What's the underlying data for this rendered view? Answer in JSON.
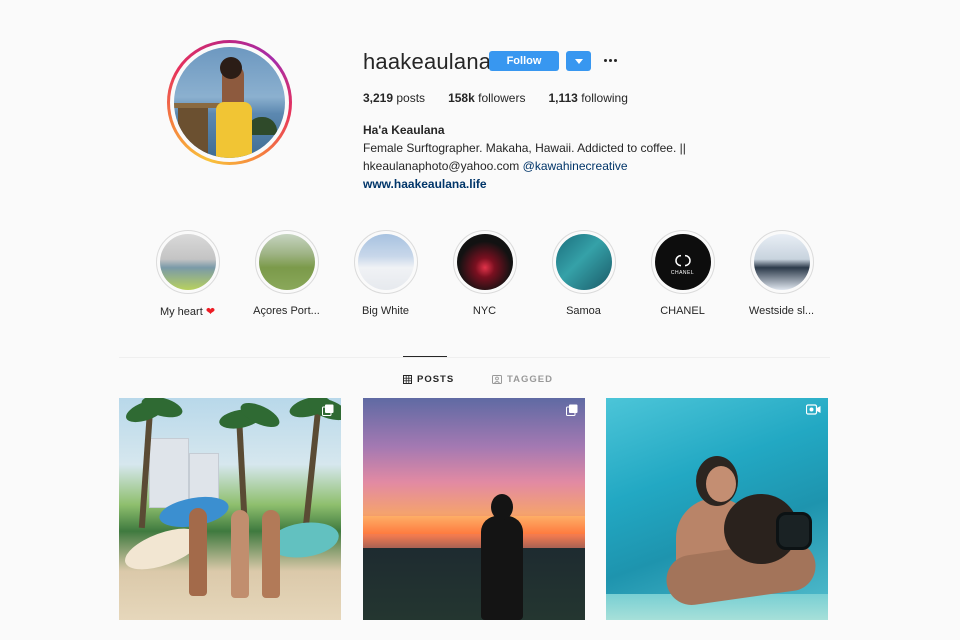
{
  "profile": {
    "username": "haakeaulana",
    "follow_label": "Follow",
    "stats": {
      "posts_count": "3,219",
      "posts_label": "posts",
      "followers_count": "158k",
      "followers_label": "followers",
      "following_count": "1,113",
      "following_label": "following"
    },
    "full_name": "Ha'a Keaulana",
    "bio_line1": "Female Surftographer. Makaha, Hawaii. Addicted to coffee. ||",
    "bio_email": "hkeaulanaphoto@yahoo.com",
    "bio_mention": "@kawahinecreative",
    "website": "www.haakeaulana.life"
  },
  "highlights": [
    {
      "label": "My heart",
      "emoji": "❤"
    },
    {
      "label": "Açores Port..."
    },
    {
      "label": "Big White"
    },
    {
      "label": "NYC"
    },
    {
      "label": "Samoa"
    },
    {
      "label": "CHANEL",
      "image_text": "CHANEL"
    },
    {
      "label": "Westside sl..."
    }
  ],
  "tabs": {
    "posts_label": "POSTS",
    "tagged_label": "TAGGED"
  },
  "posts": [
    {
      "type": "carousel",
      "icon": "carousel-icon"
    },
    {
      "type": "carousel",
      "icon": "carousel-icon"
    },
    {
      "type": "video",
      "icon": "video-icon"
    }
  ],
  "colors": {
    "accent": "#3897f0",
    "link": "#003569",
    "heart": "#ed1c24"
  }
}
